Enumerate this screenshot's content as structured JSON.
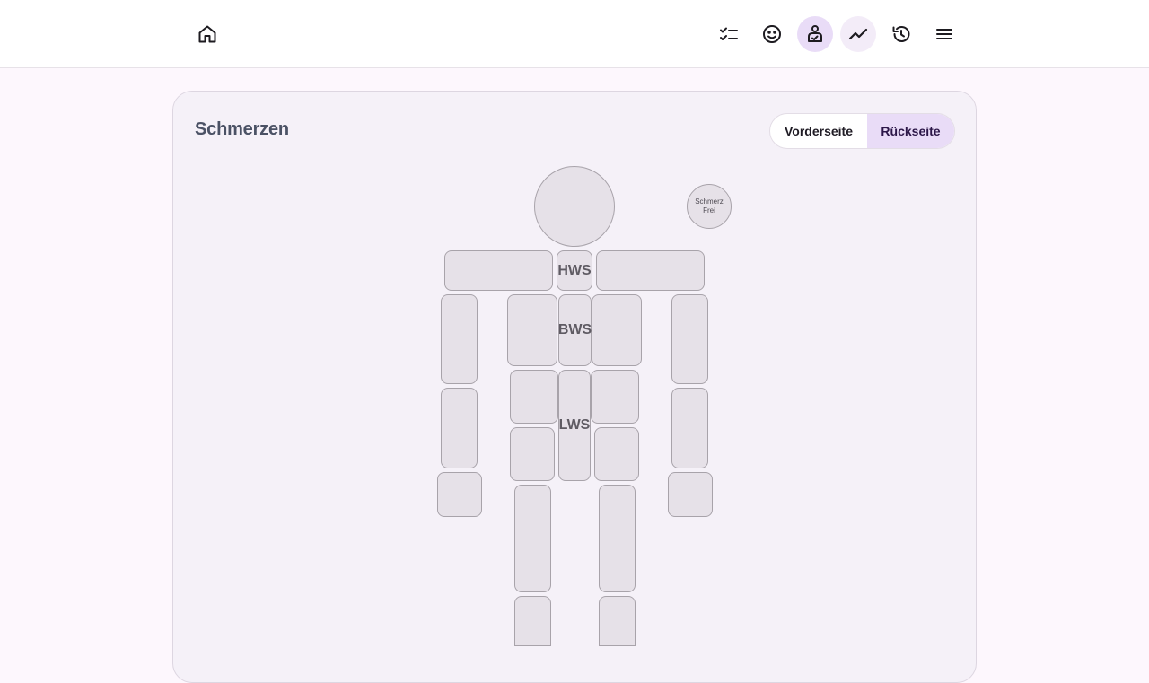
{
  "nav": {
    "home_icon": "home-icon",
    "items": [
      {
        "icon": "checklist-icon"
      },
      {
        "icon": "smiley-icon"
      },
      {
        "icon": "body-pain-icon",
        "active": true
      },
      {
        "icon": "trend-icon"
      },
      {
        "icon": "history-icon"
      },
      {
        "icon": "menu-icon"
      }
    ]
  },
  "panel": {
    "title": "Schmerzen",
    "toggle": {
      "front_label": "Vorderseite",
      "back_label": "Rückseite",
      "selected": "Rückseite"
    }
  },
  "body_map": {
    "no_pain_line1": "Schmerz",
    "no_pain_line2": "Frei",
    "hws": "HWS",
    "bws": "BWS",
    "lws": "LWS"
  },
  "colors": {
    "accent": "#e9dcf7",
    "background": "#fdf7fd",
    "card": "#f5f1f8",
    "body_part": "#e6e1e8"
  }
}
